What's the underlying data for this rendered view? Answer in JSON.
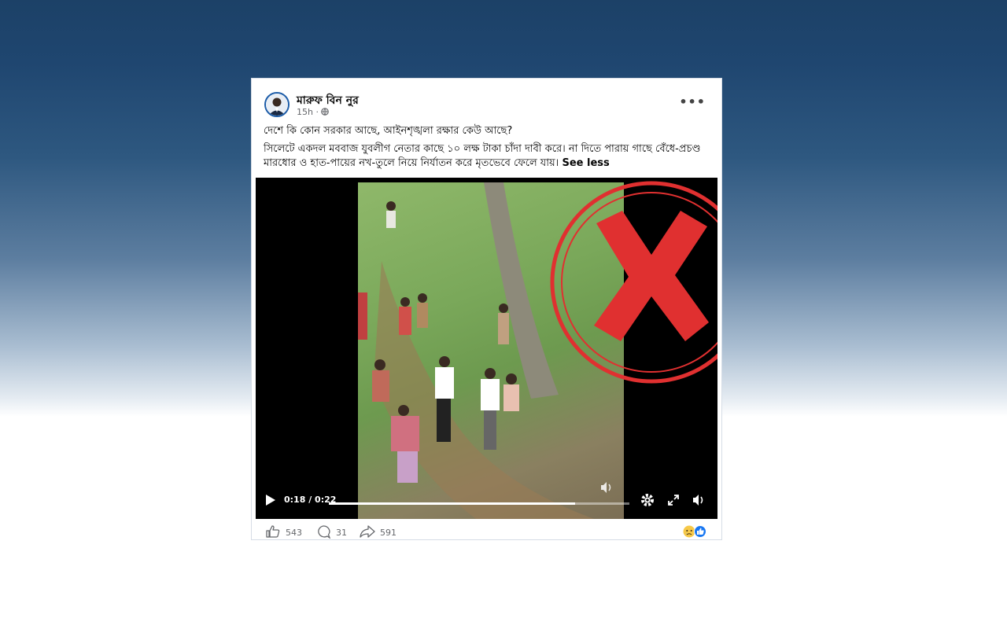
{
  "post": {
    "author": "মারুফ বিন নুর",
    "time": "15h",
    "privacy_icon": "globe-icon",
    "line1": "দেশে কি কোন সরকার আছে, আইনশৃঙ্খলা রক্ষার কেউ আছে?",
    "line2": "সিলেটে একদল মববাজ যুবলীগ নেতার কাছে ১০ লক্ষ টাকা চাঁদা দাবী করে। না দিতে পারায় গাছে বেঁধে-প্রচণ্ড মারধোর ও হাত-পায়ের নখ-তুলে নিয়ে নির্যাতন করে মৃতভেবে ফেলে যায়।",
    "see_less": "See less"
  },
  "video": {
    "time_display": "0:18 / 0:22",
    "progress": 0.82
  },
  "reactions": {
    "likes": "543",
    "comments": "31",
    "shares": "591"
  },
  "colors": {
    "stamp_red": "#e03030",
    "card_bg": "#ffffff"
  }
}
